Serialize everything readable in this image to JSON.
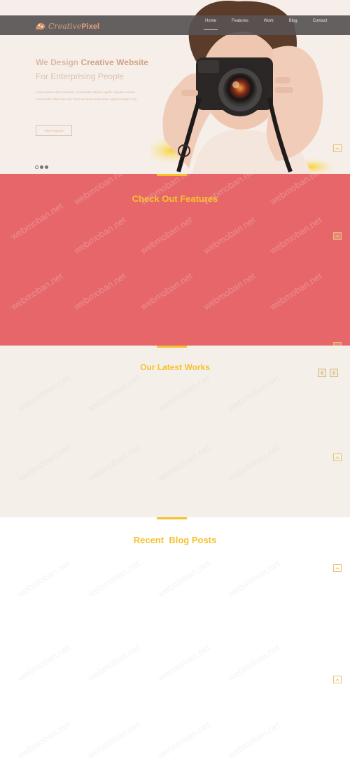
{
  "nav": {
    "logo_script": "Creative",
    "logo_bold": "Pixel",
    "items": [
      "Home",
      "Features",
      "Work",
      "Blog",
      "Contact"
    ]
  },
  "hero": {
    "title_plain": "We Design ",
    "title_bold": "Creative Website",
    "subtitle": "For Enterprising People",
    "paragraph": "Lorem ipsum dolor sit amet, consectetur adipisc ingelit. Aliquam viverra consectetur nibh a leo elit. Proin at amet consectetur adipisc tempor non.",
    "button": "View Projects"
  },
  "features": {
    "title_plain": "Check Out ",
    "title_bold": "Features"
  },
  "works": {
    "title_plain": "Our Latest ",
    "title_bold": "Works"
  },
  "blog": {
    "title_plain": "Recent ",
    "title_bold": "Blog Posts"
  },
  "watermark": "webmoban.net",
  "colors": {
    "accent": "#f5c02c",
    "features_bg": "#e6666a",
    "nav_bg": "#585454"
  }
}
